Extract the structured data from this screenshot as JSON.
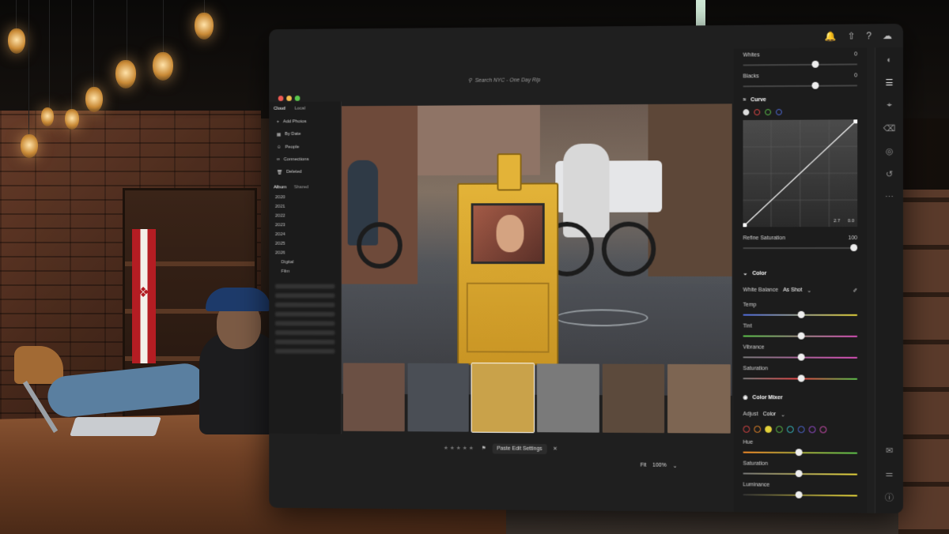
{
  "app": {
    "search_text": "Search NYC - One Day Rip"
  },
  "left_panel": {
    "tabs": [
      "Cloud",
      "Local"
    ],
    "items": [
      "Add Photos",
      "By Date",
      "People",
      "Connections",
      "Deleted"
    ],
    "album_tabs": [
      "Album",
      "Shared"
    ],
    "years": [
      "2020",
      "2021",
      "2022",
      "2023",
      "2024",
      "2025",
      "2026"
    ],
    "sub_items": [
      "Digital",
      "Film"
    ]
  },
  "right_panel": {
    "whites": {
      "label": "Whites",
      "value": "0"
    },
    "blacks": {
      "label": "Blacks",
      "value": "0"
    },
    "curve": {
      "title": "Curve",
      "readout_a": "2.7",
      "readout_b": "0.0",
      "refine_label": "Refine Saturation",
      "refine_value": "100"
    },
    "color": {
      "title": "Color",
      "wb_label": "White Balance",
      "wb_value": "As Shot",
      "sliders": [
        "Temp",
        "Tint",
        "Vibrance",
        "Saturation"
      ]
    },
    "mixer": {
      "title": "Color Mixer",
      "adjust_label": "Adjust",
      "adjust_value": "Color",
      "sliders": [
        "Hue",
        "Saturation",
        "Luminance"
      ]
    }
  },
  "bottom": {
    "stars": "★★★★★",
    "paste_label": "Paste Edit Settings",
    "fit": "Fit",
    "zoom": "100%"
  },
  "colors": {
    "accent": "#3b82f6",
    "mixer": [
      "#e34646",
      "#f08a28",
      "#e3d23a",
      "#5cc24a",
      "#38c2c8",
      "#4f6bdb",
      "#9b4fd6",
      "#d84fb8"
    ]
  }
}
